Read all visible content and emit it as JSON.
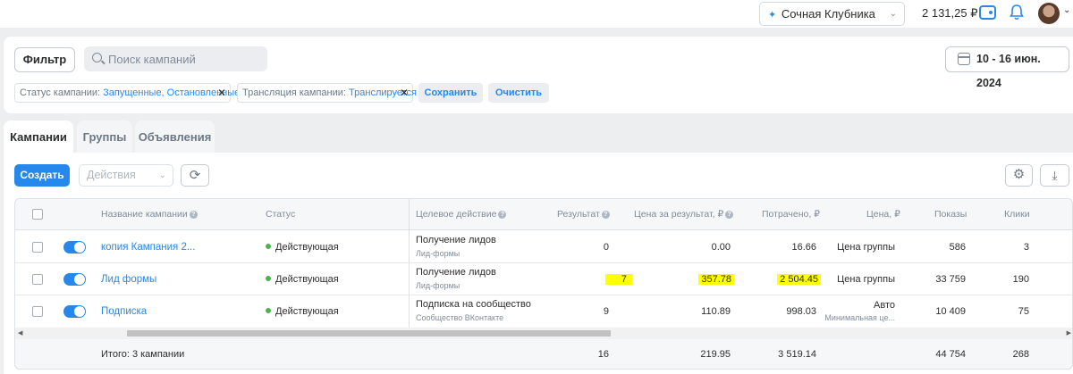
{
  "header": {
    "account_name": "Сочная Клубника",
    "balance": "2 131,25 ₽",
    "icons": [
      "sparkle-icon",
      "chevron-down-icon",
      "wallet-icon",
      "bell-icon",
      "avatar",
      "chevron-down-icon"
    ]
  },
  "filters": {
    "filter_label": "Фильтр",
    "search_placeholder": "Поиск кампаний",
    "date_range": "10 - 16 июн. 2024",
    "chips": [
      {
        "key": "Статус кампании:",
        "value": "Запущенные, Остановленные"
      },
      {
        "key": "Трансляция кампании:",
        "value": "Транслируется"
      }
    ],
    "save_label": "Сохранить",
    "clear_label": "Очистить"
  },
  "tabs": [
    {
      "label": "Кампании",
      "active": true
    },
    {
      "label": "Группы",
      "active": false
    },
    {
      "label": "Объявления",
      "active": false
    }
  ],
  "toolbar": {
    "create_label": "Создать",
    "actions_placeholder": "Действия"
  },
  "table": {
    "columns": {
      "name": "Название кампании",
      "status": "Статус",
      "target": "Целевое действие",
      "result": "Результат",
      "cost_per_result": "Цена за результат, ₽",
      "spent": "Потрачено, ₽",
      "price": "Цена, ₽",
      "impressions": "Показы",
      "clicks": "Клики"
    },
    "rows": [
      {
        "name": "копия Кампания 2...",
        "status": "Действующая",
        "target": "Получение лидов",
        "target_sub": "Лид-формы",
        "result": "0",
        "cost_per_result": "0.00",
        "spent": "16.66",
        "price": "Цена группы",
        "price_sub": "",
        "impressions": "586",
        "clicks": "3",
        "enabled": true,
        "highlighted": false
      },
      {
        "name": "Лид формы",
        "status": "Действующая",
        "target": "Получение лидов",
        "target_sub": "Лид-формы",
        "result": "7",
        "cost_per_result": "357.78",
        "spent": "2 504.45",
        "price": "Цена группы",
        "price_sub": "",
        "impressions": "33 759",
        "clicks": "190",
        "enabled": true,
        "highlighted": true
      },
      {
        "name": "Подписка",
        "status": "Действующая",
        "target": "Подписка на сообщество",
        "target_sub": "Сообщество ВКонтакте",
        "result": "9",
        "cost_per_result": "110.89",
        "spent": "998.03",
        "price": "Авто",
        "price_sub": "Минимальная це...",
        "impressions": "10 409",
        "clicks": "75",
        "enabled": true,
        "highlighted": false
      }
    ],
    "total": {
      "label": "Итого: 3 кампании",
      "result": "16",
      "cost_per_result": "219.95",
      "spent": "3 519.14",
      "impressions": "44 754",
      "clicks": "268"
    }
  },
  "colors": {
    "accent": "#2688eb",
    "status_active": "#4bb34b",
    "highlight": "#ffff00"
  }
}
